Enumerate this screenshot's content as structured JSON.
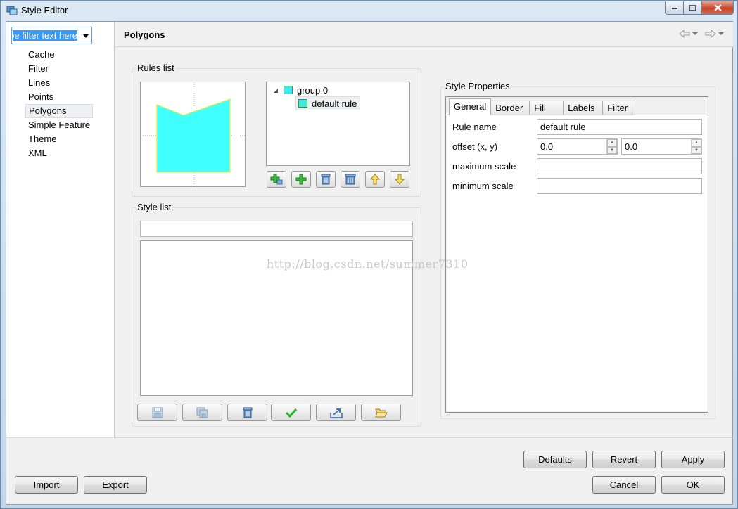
{
  "window": {
    "title": "Style Editor"
  },
  "nav": {
    "filter_text": "type filter text here",
    "items": [
      {
        "label": "Cache"
      },
      {
        "label": "Filter"
      },
      {
        "label": "Lines"
      },
      {
        "label": "Points"
      },
      {
        "label": "Polygons",
        "selected": true
      },
      {
        "label": "Simple Feature"
      },
      {
        "label": "Theme"
      },
      {
        "label": "XML"
      }
    ]
  },
  "main": {
    "title": "Polygons"
  },
  "rules": {
    "label": "Rules list",
    "tree": {
      "group": "group 0",
      "rule": "default rule"
    },
    "polygon_fill": "#40ffff",
    "polygon_stroke": "#e8e840"
  },
  "style_list": {
    "label": "Style list",
    "input_value": ""
  },
  "properties": {
    "label": "Style Properties",
    "tabs": [
      "General",
      "Border",
      "Fill",
      "Labels",
      "Filter"
    ],
    "active_tab": "General",
    "fields": {
      "rule_name_label": "Rule name",
      "rule_name_value": "default rule",
      "offset_label": "offset (x, y)",
      "offset_x": "0.0",
      "offset_y": "0.0",
      "max_scale_label": "maximum scale",
      "max_scale_value": "",
      "min_scale_label": "minimum scale",
      "min_scale_value": ""
    }
  },
  "footer": {
    "defaults": "Defaults",
    "revert": "Revert",
    "apply": "Apply",
    "import": "Import",
    "export": "Export",
    "cancel": "Cancel",
    "ok": "OK"
  },
  "watermark": "http://blog.csdn.net/summer7310"
}
